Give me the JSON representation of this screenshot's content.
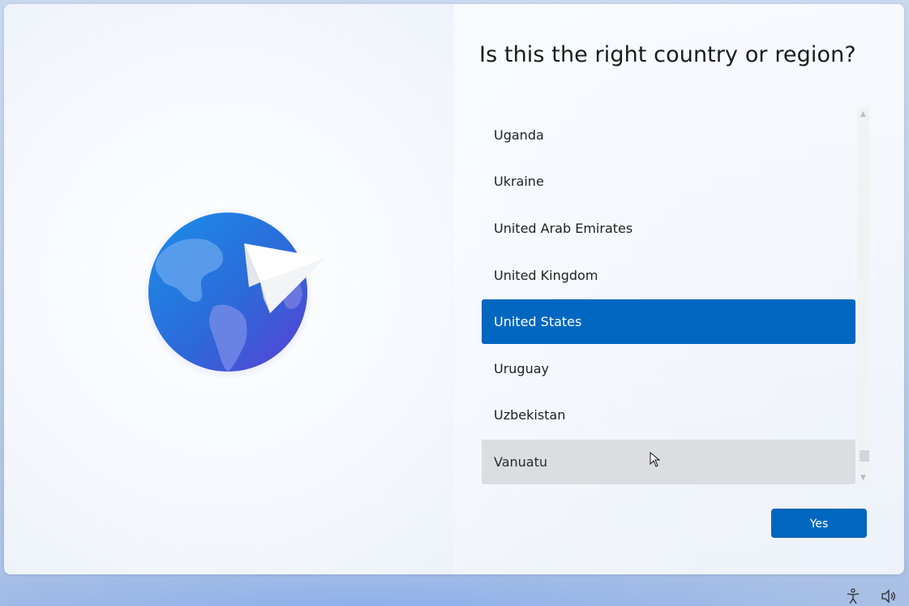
{
  "page": {
    "title": "Is this the right country or region?"
  },
  "country_list": {
    "items": [
      {
        "label": "Uganda",
        "state": "normal"
      },
      {
        "label": "Ukraine",
        "state": "normal"
      },
      {
        "label": "United Arab Emirates",
        "state": "normal"
      },
      {
        "label": "United Kingdom",
        "state": "normal"
      },
      {
        "label": "United States",
        "state": "selected"
      },
      {
        "label": "Uruguay",
        "state": "normal"
      },
      {
        "label": "Uzbekistan",
        "state": "normal"
      },
      {
        "label": "Vanuatu",
        "state": "hover"
      }
    ],
    "scroll_up_glyph": "▲",
    "scroll_down_glyph": "▼"
  },
  "actions": {
    "yes_label": "Yes"
  },
  "icons": {
    "illustration": "globe-with-paper-plane-icon",
    "cursor": "mouse-pointer-icon",
    "accessibility": "accessibility-icon",
    "volume": "volume-icon"
  },
  "colors": {
    "accent": "#0067c0",
    "hover": "#dcdde1",
    "text": "#1f1f1f"
  }
}
